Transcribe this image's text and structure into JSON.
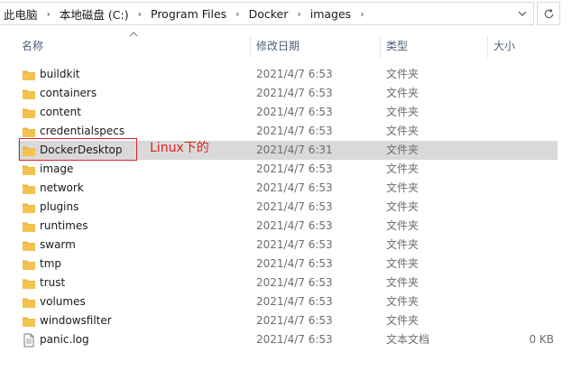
{
  "address_bar": {
    "crumbs": [
      "此电脑",
      "本地磁盘 (C:)",
      "Program Files",
      "Docker",
      "images"
    ]
  },
  "columns": {
    "name": "名称",
    "date": "修改日期",
    "type": "类型",
    "size": "大小"
  },
  "files": [
    {
      "name": "buildkit",
      "date": "2021/4/7 6:53",
      "type": "文件夹",
      "size": "",
      "icon": "folder-icon"
    },
    {
      "name": "containers",
      "date": "2021/4/7 6:53",
      "type": "文件夹",
      "size": "",
      "icon": "folder-icon"
    },
    {
      "name": "content",
      "date": "2021/4/7 6:53",
      "type": "文件夹",
      "size": "",
      "icon": "folder-icon"
    },
    {
      "name": "credentialspecs",
      "date": "2021/4/7 6:53",
      "type": "文件夹",
      "size": "",
      "icon": "folder-icon"
    },
    {
      "name": "DockerDesktop",
      "date": "2021/4/7 6:31",
      "type": "文件夹",
      "size": "",
      "icon": "folder-icon",
      "selected": true
    },
    {
      "name": "image",
      "date": "2021/4/7 6:53",
      "type": "文件夹",
      "size": "",
      "icon": "folder-icon"
    },
    {
      "name": "network",
      "date": "2021/4/7 6:53",
      "type": "文件夹",
      "size": "",
      "icon": "folder-icon"
    },
    {
      "name": "plugins",
      "date": "2021/4/7 6:53",
      "type": "文件夹",
      "size": "",
      "icon": "folder-icon"
    },
    {
      "name": "runtimes",
      "date": "2021/4/7 6:53",
      "type": "文件夹",
      "size": "",
      "icon": "folder-icon"
    },
    {
      "name": "swarm",
      "date": "2021/4/7 6:53",
      "type": "文件夹",
      "size": "",
      "icon": "folder-icon"
    },
    {
      "name": "tmp",
      "date": "2021/4/7 6:53",
      "type": "文件夹",
      "size": "",
      "icon": "folder-icon"
    },
    {
      "name": "trust",
      "date": "2021/4/7 6:53",
      "type": "文件夹",
      "size": "",
      "icon": "folder-icon"
    },
    {
      "name": "volumes",
      "date": "2021/4/7 6:53",
      "type": "文件夹",
      "size": "",
      "icon": "folder-icon"
    },
    {
      "name": "windowsfilter",
      "date": "2021/4/7 6:53",
      "type": "文件夹",
      "size": "",
      "icon": "folder-icon"
    },
    {
      "name": "panic.log",
      "date": "2021/4/7 6:53",
      "type": "文本文档",
      "size": "0 KB",
      "icon": "text-file-icon"
    }
  ],
  "annotation": {
    "text": "Linux下的",
    "color": "#e02020"
  },
  "colors": {
    "selected_row": "#d9d9d9",
    "folder": "#f4c24f",
    "header_text": "#4c607a"
  }
}
